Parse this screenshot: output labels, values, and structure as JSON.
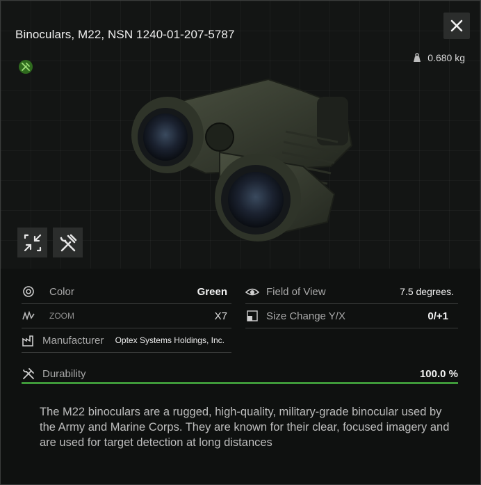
{
  "item": {
    "title": "Binoculars, M22, NSN 1240-01-207-5787",
    "weight": "0.680 kg",
    "image_icon": "binoculars-image"
  },
  "buttons": {
    "close": "×",
    "collapse_icon": "collapse-arrows-icon",
    "tools_icon": "hammer-wrench-icon"
  },
  "stats": {
    "left": [
      {
        "label": "Color",
        "value": "Green",
        "icon": "color-swirl-icon"
      },
      {
        "label": "ZOOM",
        "value": "X7",
        "icon": "zoom-wave-icon"
      },
      {
        "label": "Manufacturer",
        "value": "Optex Systems Holdings, Inc.",
        "icon": "factory-icon"
      }
    ],
    "right": [
      {
        "label": "Field of View",
        "value": "7.5 degrees.",
        "icon": "eye-icon"
      },
      {
        "label": "Size Change Y/X",
        "value": "0/+1",
        "icon": "size-square-icon"
      }
    ],
    "durability": {
      "label": "Durability",
      "value": "100.0 %",
      "fraction": 1.0,
      "icon": "tools-icon"
    }
  },
  "description": "The M22 binoculars are a rugged, high-quality, military-grade binocular used by the Army and Marine Corps. They are known for their clear, focused imagery and are used for target detection at long distances",
  "colors": {
    "accent_green": "#3f9a3a",
    "badge_green": "#2f6b1e"
  }
}
